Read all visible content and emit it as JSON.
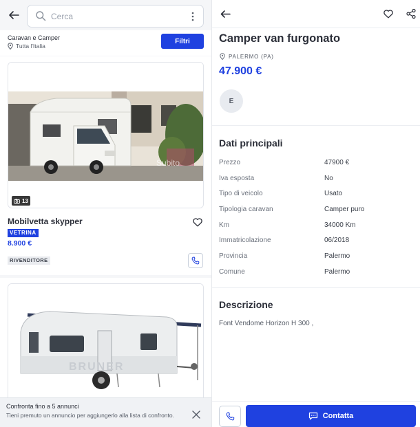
{
  "left": {
    "search": {
      "placeholder": "Cerca"
    },
    "filter_bar": {
      "category": "Caravan e Camper",
      "location": "Tutta l'Italia",
      "filter_button": "Filtri"
    },
    "listings": [
      {
        "title": "Mobilvetta skypper",
        "badge": "VETRINA",
        "price": "8.900 €",
        "seller_type": "RIVENDITORE",
        "photo_count": "13",
        "watermark": "Subito"
      },
      {
        "title": "",
        "image_text": "BRUNER"
      }
    ],
    "compare_bar": {
      "title": "Confronta fino a 5 annunci",
      "subtitle": "Tieni premuto un annuncio per aggiungerlo alla lista di confronto."
    }
  },
  "detail": {
    "title": "Camper van furgonato",
    "location": "PALERMO (PA)",
    "price": "47.900 €",
    "energy_class": "E",
    "main_data_title": "Dati principali",
    "specs": [
      {
        "label": "Prezzo",
        "value": "47900 €"
      },
      {
        "label": "Iva esposta",
        "value": "No"
      },
      {
        "label": "Tipo di veicolo",
        "value": "Usato"
      },
      {
        "label": "Tipologia caravan",
        "value": "Camper puro"
      },
      {
        "label": "Km",
        "value": "34000 Km"
      },
      {
        "label": "Immatricolazione",
        "value": "06/2018"
      },
      {
        "label": "Provincia",
        "value": "Palermo"
      },
      {
        "label": "Comune",
        "value": "Palermo"
      }
    ],
    "description_title": "Descrizione",
    "description": "Font Vendome Horizon H 300 ,",
    "contact_button": "Contatta"
  },
  "colors": {
    "brand_blue": "#1f41e0",
    "text_dark": "#2b2e38",
    "text_muted": "#6c727d",
    "background_grey": "#f5f6f8"
  },
  "icons": [
    "back-arrow-icon",
    "search-icon",
    "kebab-menu-icon",
    "location-pin-icon",
    "camera-icon",
    "heart-icon",
    "phone-icon",
    "close-icon",
    "share-icon",
    "chat-icon"
  ]
}
